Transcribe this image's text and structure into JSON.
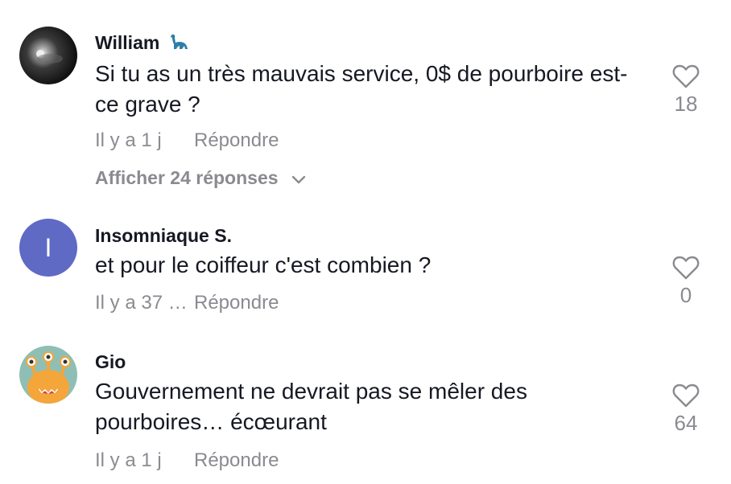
{
  "comments": [
    {
      "username": "William",
      "username_icon": "dinosaur-icon",
      "text": "Si tu as un très mauvais service, 0$ de pourboire est-ce grave ?",
      "time": "Il y a 1 j",
      "reply_label": "Répondre",
      "likes": "18",
      "view_replies": "Afficher 24 réponses"
    },
    {
      "username": "Insomniaque S.",
      "avatar_initial": "I",
      "text": "et pour le coiffeur c'est combien ?",
      "time": "Il y a 37 …",
      "reply_label": "Répondre",
      "likes": "0"
    },
    {
      "username": "Gio",
      "text": "Gouvernement ne devrait pas se mêler des pourboires… écœurant",
      "time": "Il y a 1 j",
      "reply_label": "Répondre",
      "likes": "64"
    }
  ],
  "colors": {
    "primary_text": "#161823",
    "secondary_text": "#8a8b91",
    "avatar_initial_bg": "#5e6ac4",
    "gio_avatar_bg": "#8fbfb4"
  }
}
